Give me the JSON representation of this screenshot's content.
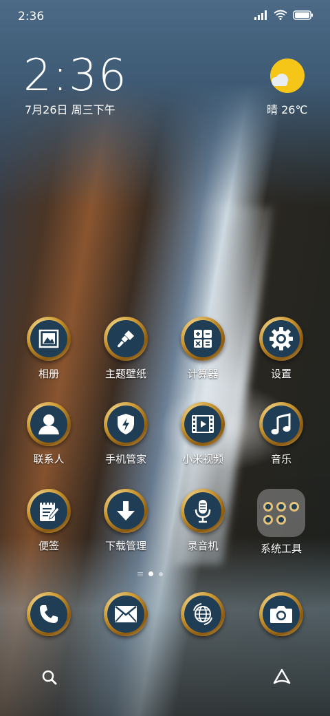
{
  "status_bar": {
    "time": "2:36",
    "icons": [
      "signal-icon",
      "wifi-icon",
      "battery-icon"
    ]
  },
  "clock_widget": {
    "time": "2:36",
    "date": "7月26日 周三下午"
  },
  "weather_widget": {
    "text": "晴 26℃",
    "icon": "sunny-cloud-icon"
  },
  "apps": [
    {
      "label": "相册",
      "icon": "gallery-icon"
    },
    {
      "label": "主题壁纸",
      "icon": "brush-icon"
    },
    {
      "label": "计算器",
      "icon": "calculator-icon"
    },
    {
      "label": "设置",
      "icon": "gear-icon"
    },
    {
      "label": "联系人",
      "icon": "contact-icon"
    },
    {
      "label": "手机管家",
      "icon": "shield-bolt-icon"
    },
    {
      "label": "小米视频",
      "icon": "film-icon"
    },
    {
      "label": "音乐",
      "icon": "music-note-icon"
    },
    {
      "label": "便签",
      "icon": "notepad-icon"
    },
    {
      "label": "下载管理",
      "icon": "download-arrow-icon"
    },
    {
      "label": "录音机",
      "icon": "microphone-icon"
    },
    {
      "label": "系统工具",
      "icon": "folder-icon"
    }
  ],
  "dock": [
    {
      "icon": "phone-icon"
    },
    {
      "icon": "mail-icon"
    },
    {
      "icon": "browser-globe-icon"
    },
    {
      "icon": "camera-icon"
    }
  ],
  "page_indicator": {
    "pages": 2,
    "current": 1
  },
  "bottom_bar": {
    "left_icon": "search-icon",
    "right_icon": "assistant-icon"
  },
  "colors": {
    "icon_disc": "#1f3e56",
    "icon_ring": "#c8942f",
    "sun": "#f5c518"
  }
}
